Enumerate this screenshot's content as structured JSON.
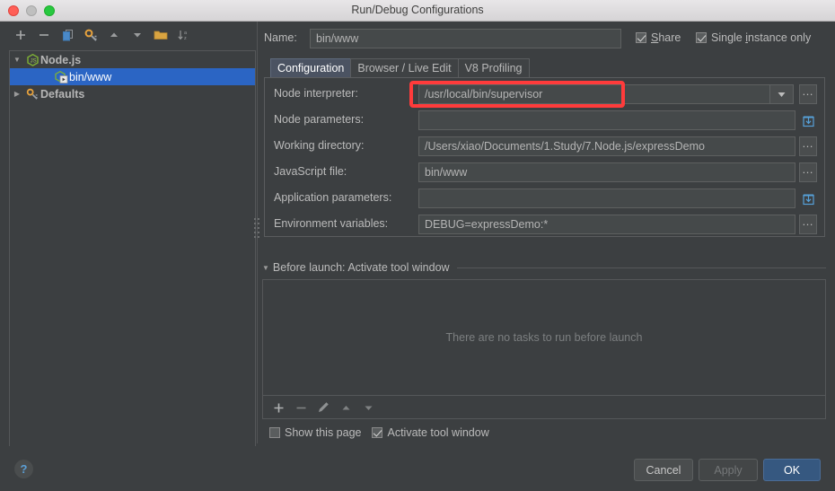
{
  "window": {
    "title": "Run/Debug Configurations",
    "traffic_lights": [
      "close",
      "minimize",
      "maximize"
    ]
  },
  "left_toolbar": {
    "buttons": [
      {
        "name": "add",
        "glyph": "+"
      },
      {
        "name": "remove",
        "glyph": "−"
      },
      {
        "name": "copy",
        "glyph": "copy-icon"
      },
      {
        "name": "edit-defaults",
        "glyph": "wrench-icon"
      },
      {
        "name": "move-up",
        "glyph": "▲"
      },
      {
        "name": "move-down",
        "glyph": "▼"
      },
      {
        "name": "folder",
        "glyph": "folder-icon"
      },
      {
        "name": "sort-alphabetically",
        "glyph": "sort-az-icon"
      }
    ]
  },
  "tree": {
    "items": [
      {
        "label": "Node.js",
        "twisty": "▼",
        "icon": "nodejs-icon",
        "bold": true,
        "selected": false,
        "indent": 0
      },
      {
        "label": "bin/www",
        "twisty": "",
        "icon": "nodejs-run-icon",
        "bold": false,
        "selected": true,
        "indent": 1
      },
      {
        "label": "Defaults",
        "twisty": "▶",
        "icon": "wrench-icon",
        "bold": true,
        "selected": false,
        "indent": 0
      }
    ]
  },
  "header": {
    "name_label": "Name:",
    "name_value": "bin/www",
    "share_label": "Share",
    "share_checked": true,
    "single_instance_label_pre": "Single ",
    "single_instance_label_key": "i",
    "single_instance_label_post": "nstance only",
    "single_instance_checked": true
  },
  "tabs": [
    {
      "label": "Configuration",
      "active": true
    },
    {
      "label": "Browser / Live Edit",
      "active": false
    },
    {
      "label": "V8 Profiling",
      "active": false
    }
  ],
  "fields": [
    {
      "label": "Node interpreter:",
      "value": "/usr/local/bin/supervisor",
      "placeholder": "",
      "has_dropdown": true,
      "trailing": "browse",
      "highlighted": true
    },
    {
      "label": "Node parameters:",
      "value": "",
      "placeholder": "",
      "has_dropdown": false,
      "trailing": "expand",
      "highlighted": false
    },
    {
      "label": "Working directory:",
      "value": "/Users/xiao/Documents/1.Study/7.Node.js/expressDemo",
      "placeholder": "",
      "has_dropdown": false,
      "trailing": "browse",
      "highlighted": false
    },
    {
      "label": "JavaScript file:",
      "value": "bin/www",
      "placeholder": "",
      "has_dropdown": false,
      "trailing": "browse",
      "highlighted": false
    },
    {
      "label": "Application parameters:",
      "value": "",
      "placeholder": "",
      "has_dropdown": false,
      "trailing": "expand",
      "highlighted": false
    },
    {
      "label": "Environment variables:",
      "value": "DEBUG=expressDemo:*",
      "placeholder": "",
      "has_dropdown": false,
      "trailing": "browse",
      "highlighted": false
    }
  ],
  "before_launch": {
    "arrow": "▼",
    "title": "Before launch: Activate tool window",
    "empty_text": "There are no tasks to run before launch",
    "toolbar": [
      {
        "name": "add-task",
        "glyph": "+",
        "enabled": true
      },
      {
        "name": "remove-task",
        "glyph": "−",
        "enabled": false
      },
      {
        "name": "edit-task",
        "glyph": "pencil-icon",
        "enabled": false
      },
      {
        "name": "move-task-up",
        "glyph": "▲",
        "enabled": false
      },
      {
        "name": "move-task-down",
        "glyph": "▼",
        "enabled": false
      }
    ],
    "show_page_label": "Show this page",
    "show_page_checked": false,
    "activate_tool_window_label": "Activate tool window",
    "activate_tool_window_checked": true
  },
  "footer": {
    "help_glyph": "?",
    "cancel_label": "Cancel",
    "apply_label": "Apply",
    "apply_enabled": false,
    "ok_label": "OK"
  },
  "annotation": {
    "color": "#ff3b3b",
    "target": "Node interpreter field"
  },
  "colors": {
    "window_bg": "#3c3f41",
    "field_bg": "#45494a",
    "selection_blue": "#2b65c4",
    "tab_active": "#4b5362",
    "primary_button": "#365880",
    "highlight_red": "#ff3b3b"
  }
}
